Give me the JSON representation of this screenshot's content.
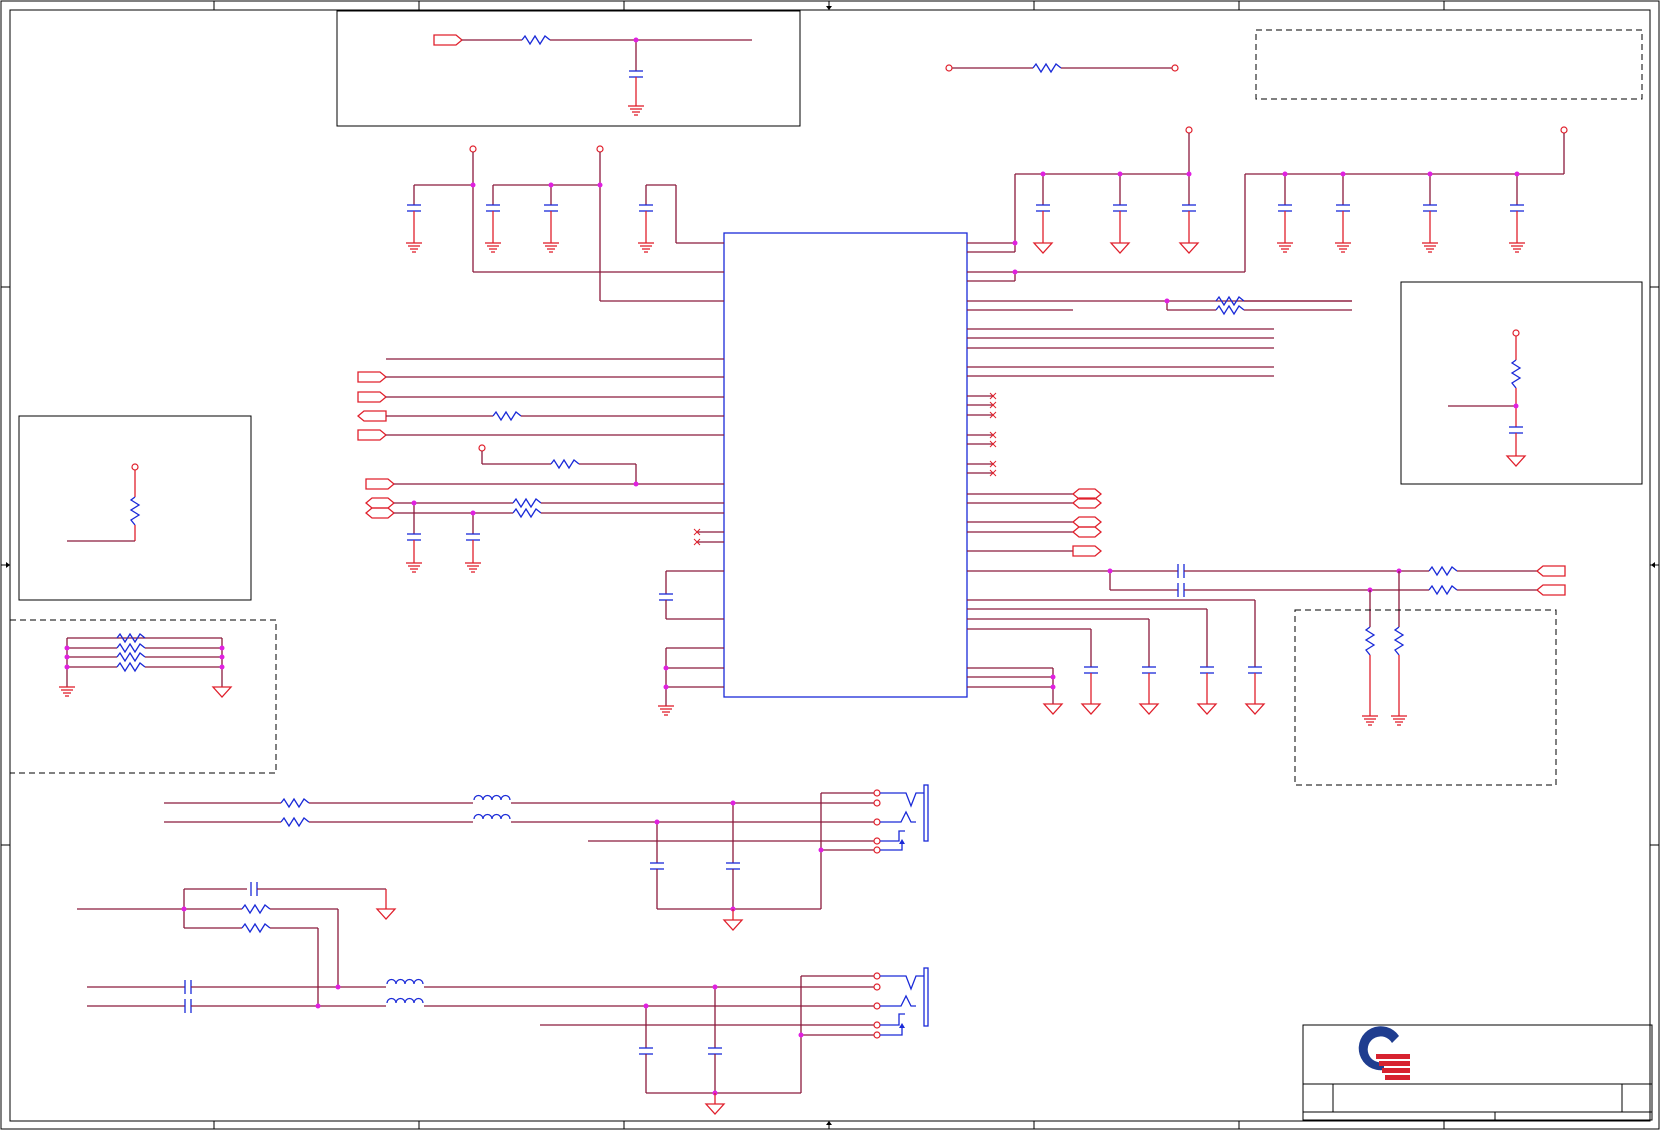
{
  "sheet": {
    "zone_columns": 8,
    "zone_rows": 4
  },
  "title_block": {
    "logo_icon": "company-q-logo-icon",
    "logo_colors": {
      "ring": "#1f3d8f",
      "stripes": "#d7222f"
    },
    "fields": [
      "",
      "",
      "",
      ""
    ]
  },
  "colors": {
    "wire": "#8b1a3c",
    "component": "#e0202c",
    "ic_outline": "#1a2ad8",
    "junction": "#e020e0"
  }
}
